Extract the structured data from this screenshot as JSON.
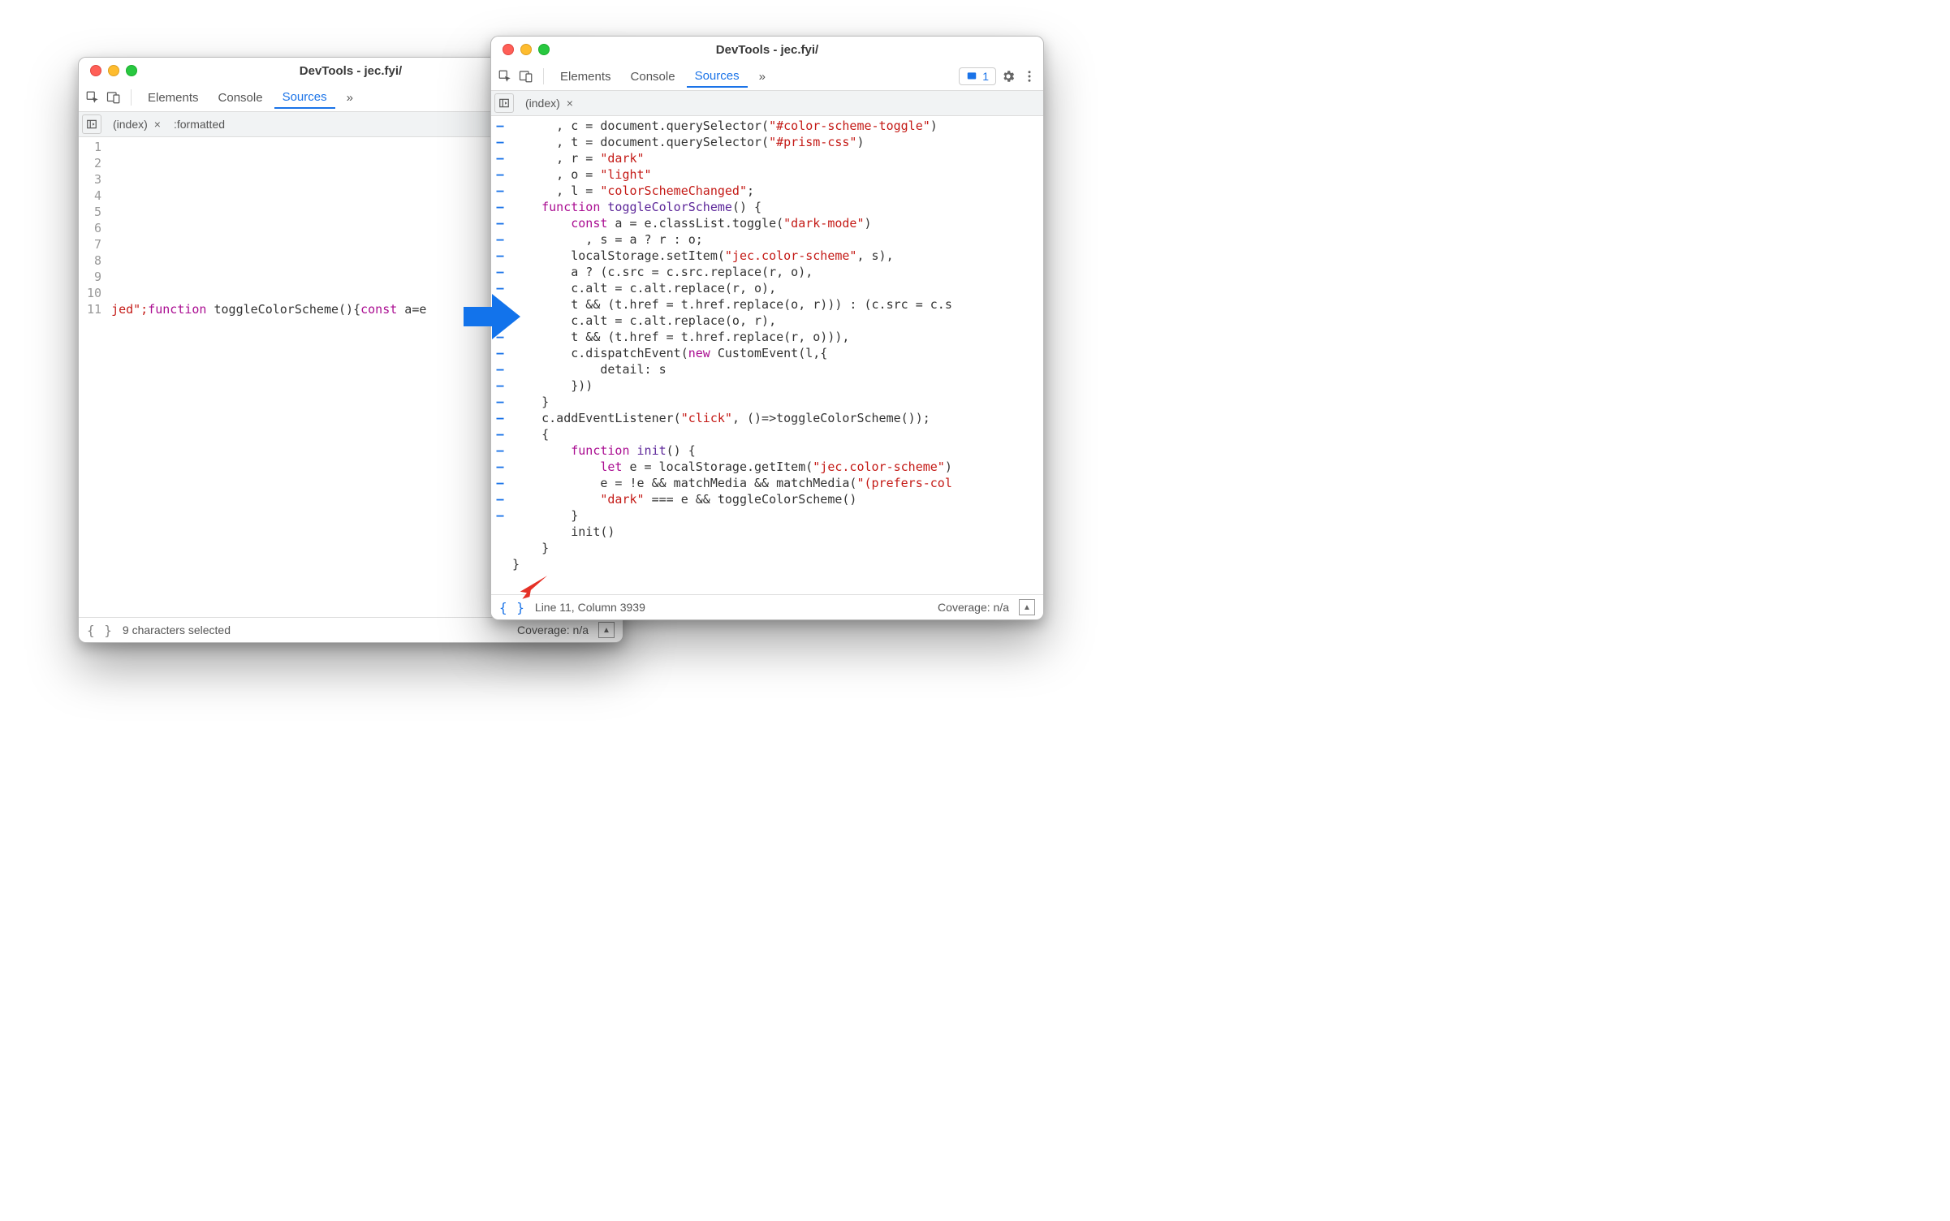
{
  "left": {
    "title": "DevTools - jec.fyi/",
    "toolbar": {
      "tabs": [
        "Elements",
        "Console",
        "Sources"
      ],
      "active": 2,
      "overflow": "»"
    },
    "files": {
      "tabs": [
        {
          "name": "(index)",
          "closable": true
        },
        {
          "name": ":formatted",
          "closable": false
        }
      ],
      "active": 0
    },
    "gutter_lines": [
      "1",
      "2",
      "3",
      "4",
      "5",
      "6",
      "7",
      "8",
      "9",
      "10",
      "11"
    ],
    "code_line11": {
      "pre": "jed\";",
      "kw1": "function",
      "fn": " toggleColorScheme(){",
      "kw2": "const",
      "rest": " a=e"
    },
    "status": {
      "selected": "9 characters selected",
      "coverage": "Coverage: n/a"
    }
  },
  "right": {
    "title": "DevTools - jec.fyi/",
    "toolbar": {
      "tabs": [
        "Elements",
        "Console",
        "Sources"
      ],
      "active": 2,
      "overflow": "»",
      "issues_count": "1"
    },
    "files": {
      "tabs": [
        {
          "name": "(index)",
          "closable": true
        }
      ],
      "active": 0
    },
    "marker_rows": 25,
    "code_lines": [
      [
        {
          "t": "      , c = document.querySelector("
        },
        {
          "t": "\"#color-scheme-toggle\"",
          "c": "s"
        },
        {
          "t": ")"
        }
      ],
      [
        {
          "t": "      , t = document.querySelector("
        },
        {
          "t": "\"#prism-css\"",
          "c": "s"
        },
        {
          "t": ")"
        }
      ],
      [
        {
          "t": "      , r = "
        },
        {
          "t": "\"dark\"",
          "c": "s"
        }
      ],
      [
        {
          "t": "      , o = "
        },
        {
          "t": "\"light\"",
          "c": "s"
        }
      ],
      [
        {
          "t": "      , l = "
        },
        {
          "t": "\"colorSchemeChanged\"",
          "c": "s"
        },
        {
          "t": ";"
        }
      ],
      [
        {
          "t": "    "
        },
        {
          "t": "function",
          "c": "k"
        },
        {
          "t": " "
        },
        {
          "t": "toggleColorScheme",
          "c": "f"
        },
        {
          "t": "() {"
        }
      ],
      [
        {
          "t": "        "
        },
        {
          "t": "const",
          "c": "k"
        },
        {
          "t": " a = e.classList.toggle("
        },
        {
          "t": "\"dark-mode\"",
          "c": "s"
        },
        {
          "t": ")"
        }
      ],
      [
        {
          "t": "          , s = a ? r : o;"
        }
      ],
      [
        {
          "t": "        localStorage.setItem("
        },
        {
          "t": "\"jec.color-scheme\"",
          "c": "s"
        },
        {
          "t": ", s),"
        }
      ],
      [
        {
          "t": "        a ? (c.src = c.src.replace(r, o),"
        }
      ],
      [
        {
          "t": "        c.alt = c.alt.replace(r, o),"
        }
      ],
      [
        {
          "t": "        t && (t.href = t.href.replace(o, r))) : (c.src = c.s"
        }
      ],
      [
        {
          "t": "        c.alt = c.alt.replace(o, r),"
        }
      ],
      [
        {
          "t": "        t && (t.href = t.href.replace(r, o))),"
        }
      ],
      [
        {
          "t": "        c.dispatchEvent("
        },
        {
          "t": "new",
          "c": "k"
        },
        {
          "t": " CustomEvent(l,{"
        }
      ],
      [
        {
          "t": "            detail: s"
        }
      ],
      [
        {
          "t": "        }))"
        }
      ],
      [
        {
          "t": "    }"
        }
      ],
      [
        {
          "t": "    c.addEventListener("
        },
        {
          "t": "\"click\"",
          "c": "s"
        },
        {
          "t": ", ()=>toggleColorScheme());"
        }
      ],
      [
        {
          "t": "    {"
        }
      ],
      [
        {
          "t": "        "
        },
        {
          "t": "function",
          "c": "k"
        },
        {
          "t": " "
        },
        {
          "t": "init",
          "c": "f"
        },
        {
          "t": "() {"
        }
      ],
      [
        {
          "t": "            "
        },
        {
          "t": "let",
          "c": "k"
        },
        {
          "t": " e = localStorage.getItem("
        },
        {
          "t": "\"jec.color-scheme\"",
          "c": "s"
        },
        {
          "t": ")"
        }
      ],
      [
        {
          "t": "            e = !e && matchMedia && matchMedia("
        },
        {
          "t": "\"(prefers-col",
          "c": "s"
        }
      ],
      [
        {
          "t": "            "
        },
        {
          "t": "\"dark\"",
          "c": "s"
        },
        {
          "t": " === e && toggleColorScheme()"
        }
      ],
      [
        {
          "t": "        }"
        }
      ],
      [
        {
          "t": "        init()"
        }
      ],
      [
        {
          "t": "    }"
        }
      ],
      [
        {
          "t": "}"
        }
      ]
    ],
    "status": {
      "position": "Line 11, Column 3939",
      "coverage": "Coverage: n/a"
    }
  }
}
